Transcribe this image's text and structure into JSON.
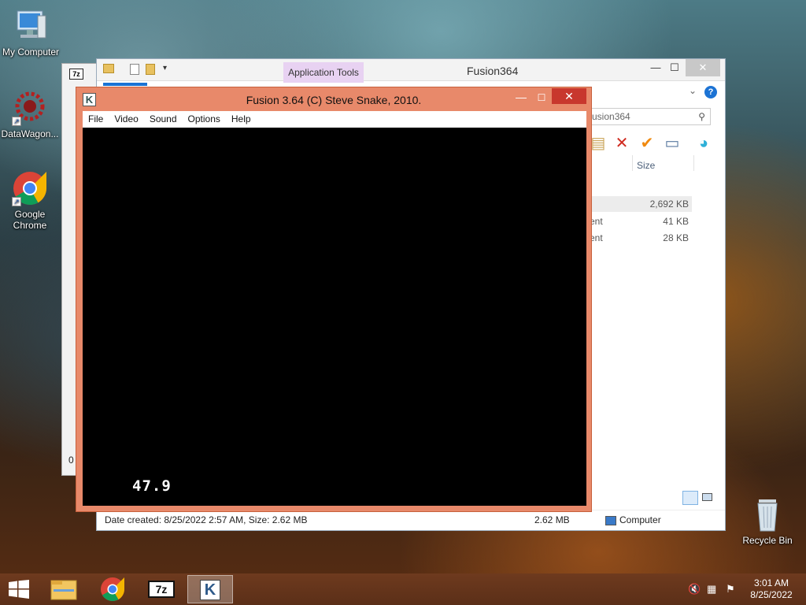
{
  "desktop": {
    "icons": [
      {
        "label": "My Computer",
        "icon": "computer-icon"
      },
      {
        "label": "DataWagon...",
        "icon": "datawagon-icon"
      },
      {
        "label": "Google Chrome",
        "icon": "chrome-icon"
      },
      {
        "label": "Recycle Bin",
        "icon": "recycle-bin-icon"
      }
    ]
  },
  "explorer": {
    "title": "Fusion364",
    "context_tab": "Application Tools",
    "search_placeholder": "usion364",
    "column_size": "Size",
    "rows": [
      {
        "type": "",
        "size": "2,692 KB"
      },
      {
        "type": "ent",
        "size": "41 KB"
      },
      {
        "type": "ent",
        "size": "28 KB"
      }
    ],
    "status_left": "Date created: 8/25/2022 2:57 AM, Size: 2.62 MB",
    "status_size": "2.62 MB",
    "status_location": "Computer",
    "left_count": "0"
  },
  "fusion": {
    "title": "Fusion 3.64 (C) Steve Snake, 2010.",
    "menu": [
      "File",
      "Video",
      "Sound",
      "Options",
      "Help"
    ],
    "fps": "47.9"
  },
  "taskbar": {
    "time": "3:01 AM",
    "date": "8/25/2022",
    "apps": [
      "file-explorer",
      "google-chrome",
      "7-zip",
      "kega-fusion"
    ]
  },
  "colors": {
    "fusion_frame": "#e8896a",
    "close_red": "#c8372d",
    "taskbar": "#6e3a1e"
  }
}
